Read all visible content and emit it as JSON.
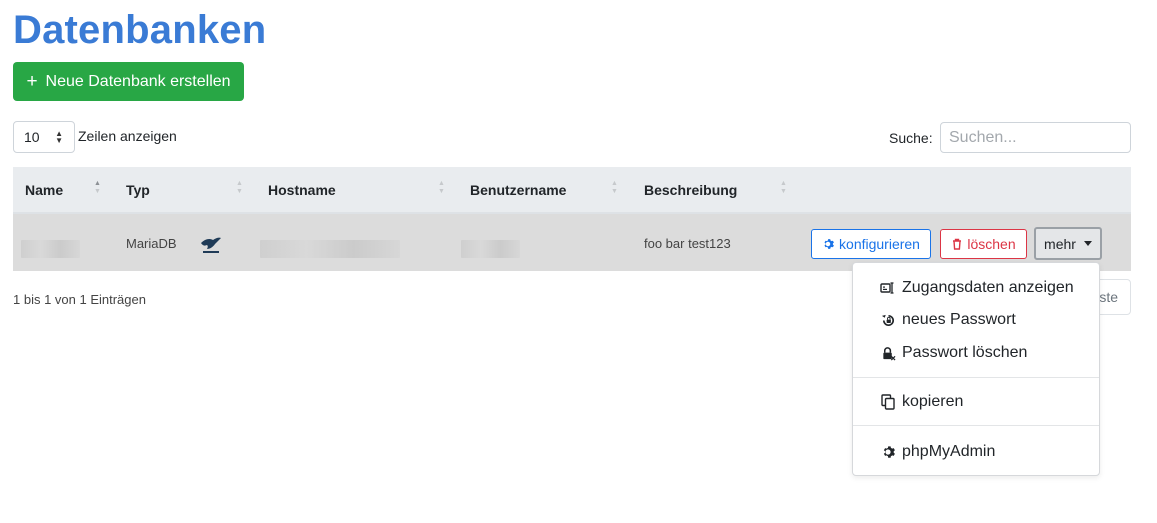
{
  "page": {
    "title": "Datenbanken"
  },
  "toolbar": {
    "create_label": "Neue Datenbank erstellen",
    "create_icon": "plus-icon"
  },
  "table_controls": {
    "length_value": "10",
    "length_label": "Zeilen anzeigen",
    "search_label": "Suche:",
    "search_placeholder": "Suchen..."
  },
  "table": {
    "columns": [
      "Name",
      "Typ",
      "Hostname",
      "Benutzername",
      "Beschreibung"
    ],
    "rows": [
      {
        "name": "",
        "type": "MariaDB",
        "type_icon": "mariadb-logo-icon",
        "hostname": "",
        "username": "",
        "description": "foo bar test123"
      }
    ],
    "actions": {
      "configure_label": "konfigurieren",
      "delete_label": "löschen",
      "more_label": "mehr"
    },
    "info": "1 bis 1 von 1 Einträgen",
    "pager_visible_text": "ste"
  },
  "dropdown": {
    "items": [
      {
        "label": "Zugangsdaten anzeigen",
        "icon": "credentials-icon"
      },
      {
        "label": "neues Passwort",
        "icon": "reset-password-icon"
      },
      {
        "label": "Passwort löschen",
        "icon": "lock-remove-icon"
      },
      {
        "label": "kopieren",
        "icon": "copy-icon"
      },
      {
        "label": "phpMyAdmin",
        "icon": "gear-icon"
      }
    ]
  },
  "colors": {
    "title": "#3a7bd5",
    "success": "#28a745",
    "primary": "#1a73e8",
    "danger": "#dc3545",
    "table_header_bg": "#e9ecef",
    "row_bg": "#dcdcdc"
  }
}
